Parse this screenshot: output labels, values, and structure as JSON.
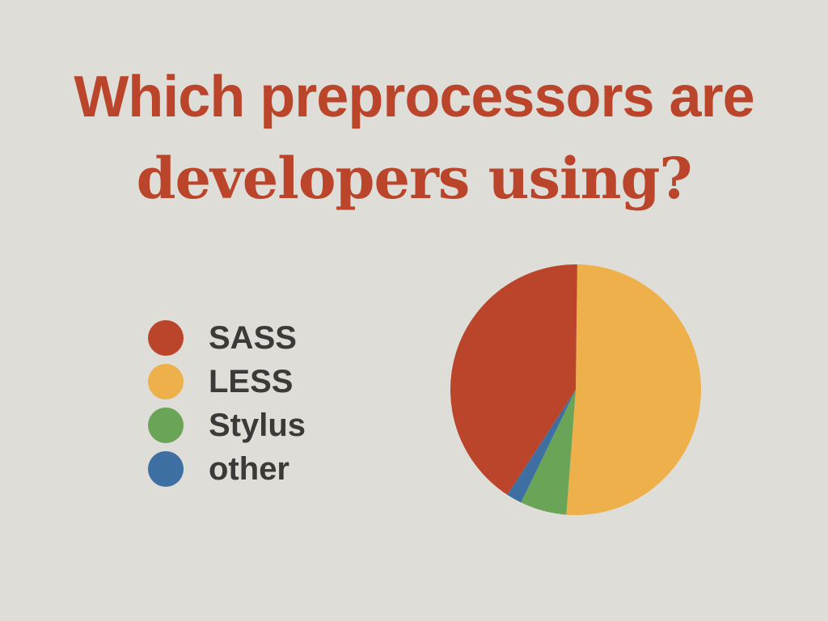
{
  "chart_data": {
    "type": "pie",
    "title_line_1": "Which preprocessors are",
    "title_line_2": "developers using?",
    "categories": [
      "SASS",
      "LESS",
      "Stylus",
      "other"
    ],
    "values": [
      41,
      51,
      6,
      2
    ],
    "colors": [
      "#ba452b",
      "#edb04b",
      "#6aa457",
      "#3e6fa3"
    ],
    "legend_placement": "left"
  }
}
